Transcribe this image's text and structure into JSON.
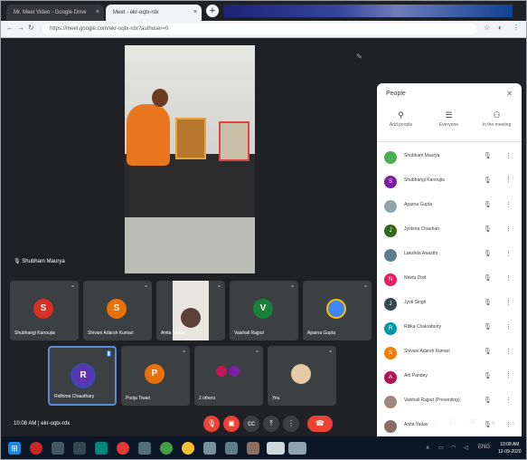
{
  "browser": {
    "tabs": [
      {
        "label": "Mr. Meet Video - Google Drive"
      },
      {
        "label": "Meet - ekr-oqtx-rdx"
      }
    ],
    "new_tab": "+",
    "url": "https://meet.google.com/ekr-oqtx-rdx?authuser=0"
  },
  "meeting": {
    "main_speaker": "Shubham Maurya",
    "tiles_row1": [
      {
        "name": "Shubhangi Kanoujia",
        "initial": "S",
        "color": "#d93025"
      },
      {
        "name": "Shivani Adarsh Kumari",
        "initial": "S",
        "color": "#e8710a"
      },
      {
        "name": "Anita Yadav",
        "initial": "",
        "color": "#8d6e63"
      },
      {
        "name": "Vaishali Rajput",
        "initial": "V",
        "color": "#188038"
      },
      {
        "name": "Aparna Gupta",
        "initial": "",
        "color": "#4285f4"
      }
    ],
    "tiles_row2": [
      {
        "name": "Ridhima Chaudhary",
        "initial": "R",
        "color": "#5e35b1"
      },
      {
        "name": "Pooja Tiwari",
        "initial": "P",
        "color": "#e8710a"
      },
      {
        "name": "2 others",
        "initial": "",
        "color": "#c2185b"
      },
      {
        "name": "You",
        "initial": "",
        "color": "#e6c9a8"
      }
    ],
    "bottom": {
      "time_label": "10:08 AM  |  ekr-oqtx-rdx"
    }
  },
  "people_panel": {
    "title": "People",
    "close": "✕",
    "tabs": [
      {
        "label": "Add people",
        "icon": "add-person-icon"
      },
      {
        "label": "Everyone",
        "icon": "group-icon"
      },
      {
        "label": "In the meeting",
        "icon": "people-icon"
      }
    ],
    "participants": [
      {
        "name": "Shubham Maurya",
        "color": "#4caf50",
        "initial": ""
      },
      {
        "name": "Shubhangi Kanoujia",
        "color": "#7b1fa2",
        "initial": "S"
      },
      {
        "name": "Aparna Gupta",
        "color": "#90a4ae",
        "initial": ""
      },
      {
        "name": "Jyotsna Chauhan",
        "color": "#33691e",
        "initial": "J"
      },
      {
        "name": "Lakshita Awasthi",
        "color": "#607d8b",
        "initial": ""
      },
      {
        "name": "Neetu Dixit",
        "color": "#e91e63",
        "initial": "N"
      },
      {
        "name": "Jyoti Singh",
        "color": "#37474f",
        "initial": "J"
      },
      {
        "name": "Ritika Chakraborty",
        "color": "#0097a7",
        "initial": "R"
      },
      {
        "name": "Shivani Adarsh Kumari",
        "color": "#f57c00",
        "initial": "S"
      },
      {
        "name": "Arti Pandey",
        "color": "#ad1457",
        "initial": "A"
      },
      {
        "name": "Vaishali Rajput (Presenting)",
        "color": "#a1887f",
        "initial": ""
      },
      {
        "name": "Anita Yadav",
        "color": "#8d6e63",
        "initial": ""
      }
    ]
  },
  "taskbar": {
    "clock_time": "10:08 AM",
    "clock_date": "12-09-2020",
    "lang": "ENG"
  }
}
